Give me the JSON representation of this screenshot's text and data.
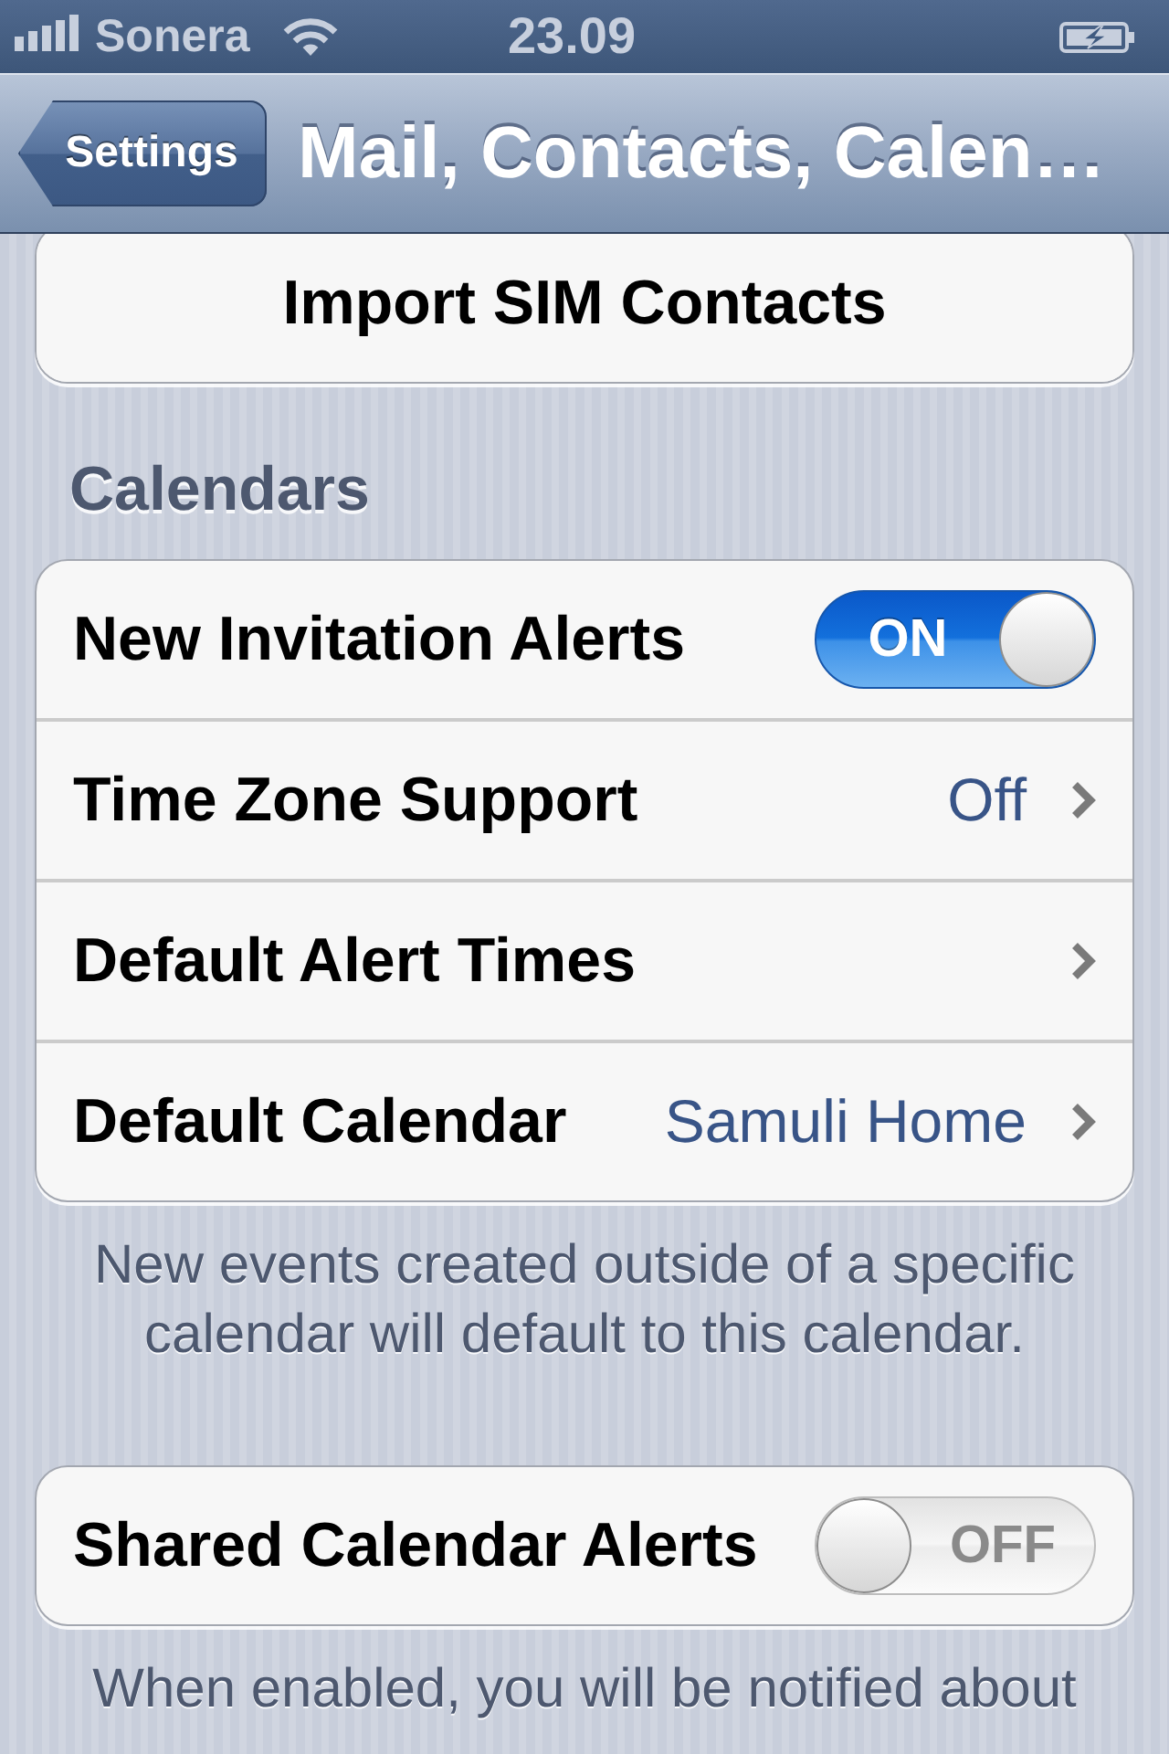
{
  "status_bar": {
    "carrier": "Sonera",
    "time": "23.09"
  },
  "nav_bar": {
    "back_button": "Settings",
    "title": "Mail, Contacts, Calen…"
  },
  "sections": [
    {
      "rows": [
        {
          "kind": "button",
          "label": "Import SIM Contacts"
        }
      ]
    },
    {
      "header": "Calendars",
      "rows": [
        {
          "kind": "toggle",
          "label": "New Invitation Alerts",
          "on": true,
          "switch_label": "ON"
        },
        {
          "kind": "disclosure",
          "label": "Time Zone Support",
          "value": "Off"
        },
        {
          "kind": "disclosure",
          "label": "Default Alert Times"
        },
        {
          "kind": "disclosure",
          "label": "Default Calendar",
          "value": "Samuli Home"
        }
      ],
      "footer": "New events created outside of a specific calendar will default to this calendar."
    },
    {
      "rows": [
        {
          "kind": "toggle",
          "label": "Shared Calendar Alerts",
          "on": false,
          "switch_label": "OFF"
        }
      ],
      "footer": "When enabled, you will be notified about"
    }
  ]
}
